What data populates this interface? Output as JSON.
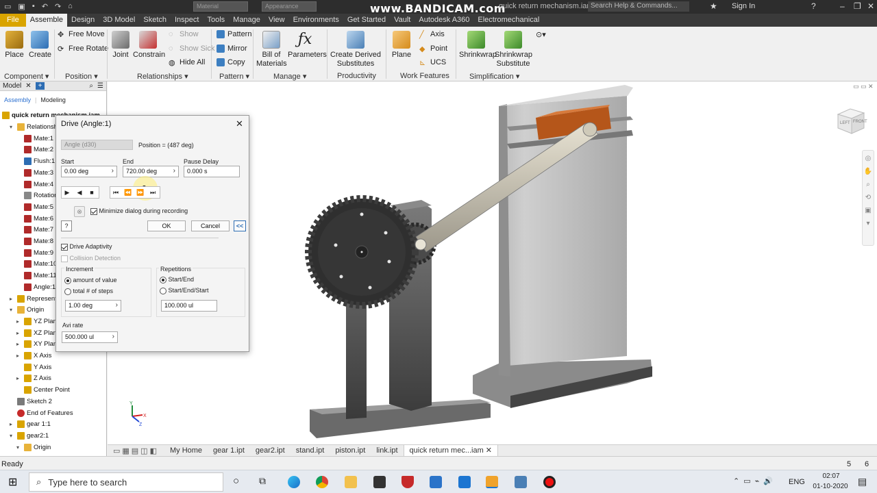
{
  "window": {
    "workspace_combo": "Material",
    "appearance_combo": "Appearance",
    "doc_title": "quick return mechanism.iam",
    "watermark": "www.BANDICAM.com",
    "search_placeholder": "Search Help & Commands...",
    "sign_in": "Sign In"
  },
  "ribbon_tabs": [
    "File",
    "Assemble",
    "Design",
    "3D Model",
    "Sketch",
    "Inspect",
    "Tools",
    "Manage",
    "View",
    "Environments",
    "Get Started",
    "Vault",
    "Autodesk A360",
    "Electromechanical"
  ],
  "ribbon": {
    "place": "Place",
    "create": "Create",
    "free_move": "Free Move",
    "free_rotate": "Free Rotate",
    "joint": "Joint",
    "constrain": "Constrain",
    "show": "Show",
    "show_sick": "Show Sick",
    "hide_all": "Hide All",
    "pattern": "Pattern",
    "mirror": "Mirror",
    "copy": "Copy",
    "bom1": "Bill of",
    "bom2": "Materials",
    "parameters": "Parameters",
    "cds1": "Create Derived",
    "cds2": "Substitutes",
    "plane": "Plane",
    "axis": "Axis",
    "point": "Point",
    "ucs": "UCS",
    "shrinkwrap": "Shrinkwrap",
    "sws1": "Shrinkwrap",
    "sws2": "Substitute",
    "panels": {
      "component": "Component",
      "position": "Position",
      "relationships": "Relationships",
      "pattern": "Pattern",
      "manage": "Manage",
      "productivity": "Productivity",
      "work_features": "Work Features",
      "simplification": "Simplification"
    }
  },
  "browser": {
    "tab_model": "Model",
    "sub_assembly": "Assembly",
    "sub_modeling": "Modeling",
    "root": "quick return mechanism.iam",
    "items": [
      {
        "label": "Relationships",
        "indent": 1,
        "exp": "▾",
        "icon": "folder"
      },
      {
        "label": "Mate:1",
        "indent": 2,
        "exp": "",
        "icon": "mate"
      },
      {
        "label": "Mate:2",
        "indent": 2,
        "exp": "",
        "icon": "mate"
      },
      {
        "label": "Flush:1",
        "indent": 2,
        "exp": "",
        "icon": "flush"
      },
      {
        "label": "Mate:3 (2",
        "indent": 2,
        "exp": "",
        "icon": "mate"
      },
      {
        "label": "Mate:4",
        "indent": 2,
        "exp": "",
        "icon": "mate"
      },
      {
        "label": "Rotation:1",
        "indent": 2,
        "exp": "",
        "icon": "rotation"
      },
      {
        "label": "Mate:5",
        "indent": 2,
        "exp": "",
        "icon": "mate2"
      },
      {
        "label": "Mate:6",
        "indent": 2,
        "exp": "",
        "icon": "mate2"
      },
      {
        "label": "Mate:7",
        "indent": 2,
        "exp": "",
        "icon": "mate"
      },
      {
        "label": "Mate:8",
        "indent": 2,
        "exp": "",
        "icon": "mate"
      },
      {
        "label": "Mate:9",
        "indent": 2,
        "exp": "",
        "icon": "mate2"
      },
      {
        "label": "Mate:10",
        "indent": 2,
        "exp": "",
        "icon": "mate2"
      },
      {
        "label": "Mate:11",
        "indent": 2,
        "exp": "",
        "icon": "mate"
      },
      {
        "label": "Angle:1 (2",
        "indent": 2,
        "exp": "",
        "icon": "angle"
      },
      {
        "label": "Representation",
        "indent": 1,
        "exp": "▸",
        "icon": "rep"
      },
      {
        "label": "Origin",
        "indent": 1,
        "exp": "▾",
        "icon": "folder"
      },
      {
        "label": "YZ Plane",
        "indent": 2,
        "exp": "▸",
        "icon": "plane"
      },
      {
        "label": "XZ Plane",
        "indent": 2,
        "exp": "▸",
        "icon": "plane"
      },
      {
        "label": "XY Plane",
        "indent": 2,
        "exp": "▸",
        "icon": "plane"
      },
      {
        "label": "X Axis",
        "indent": 2,
        "exp": "▸",
        "icon": "axis"
      },
      {
        "label": "Y Axis",
        "indent": 2,
        "exp": "",
        "icon": "axis"
      },
      {
        "label": "Z Axis",
        "indent": 2,
        "exp": "▸",
        "icon": "axis"
      },
      {
        "label": "Center Point",
        "indent": 2,
        "exp": "",
        "icon": "point"
      },
      {
        "label": "Sketch 2",
        "indent": 1,
        "exp": "",
        "icon": "sketch"
      },
      {
        "label": "End of Features",
        "indent": 1,
        "exp": "",
        "icon": "eof"
      },
      {
        "label": "gear 1:1",
        "indent": 1,
        "exp": "▸",
        "icon": "part"
      },
      {
        "label": "gear2:1",
        "indent": 1,
        "exp": "▾",
        "icon": "part"
      },
      {
        "label": "Origin",
        "indent": 2,
        "exp": "▾",
        "icon": "folder"
      }
    ]
  },
  "dialog": {
    "title": "Drive (Angle:1)",
    "angle_field": "Angle (d30)",
    "position": "Position = (487 deg)",
    "start_label": "Start",
    "start_value": "0.00 deg",
    "end_label": "End",
    "end_value": "720.00 deg",
    "pause_label": "Pause Delay",
    "pause_value": "0.000 s",
    "minimize_label": "Minimize dialog during recording",
    "ok": "OK",
    "cancel": "Cancel",
    "more": "<<",
    "help": "?",
    "drive_adaptivity": "Drive Adaptivity",
    "collision_detection": "Collision Detection",
    "increment_label": "Increment",
    "amount_of_value": "amount of value",
    "total_steps": "total # of steps",
    "increment_value": "1.00 deg",
    "repetitions_label": "Repetitions",
    "start_end": "Start/End",
    "start_end_start": "Start/End/Start",
    "repetitions_value": "100.000 ul",
    "avi_rate_label": "Avi rate",
    "avi_rate_value": "500.000 ul"
  },
  "doc_tabs": [
    "My Home",
    "gear 1.ipt",
    "gear2.ipt",
    "stand.ipt",
    "piston.ipt",
    "link.ipt",
    "quick return mec...iam"
  ],
  "status": {
    "left": "Ready",
    "num1": "5",
    "num2": "6"
  },
  "taskbar": {
    "search_placeholder": "Type here to search",
    "lang": "ENG",
    "time": "02:07",
    "date": "01-10-2020"
  },
  "viewcube": {
    "left": "LEFT",
    "front": "FRONT"
  },
  "colors": {
    "accent": "#d9a400",
    "slider_block": "#b5561a",
    "metal_dark": "#3a3a3a",
    "metal_light": "#c7c7c7"
  }
}
